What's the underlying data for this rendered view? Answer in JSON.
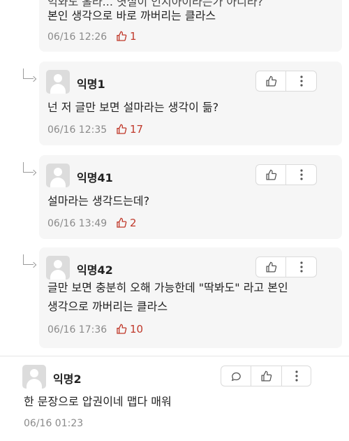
{
  "top_comment": {
    "line1": "억와도  홀라...  엿실이 인지아이라는가 아니라?",
    "line2": "본인 생각으로 바로 까버리는 클라스",
    "time": "06/16 12:26",
    "likes": "1"
  },
  "replies": [
    {
      "nickname": "익명1",
      "text": "넌 저 글만 보면 설마라는 생각이 듦?",
      "time": "06/16 12:35",
      "likes": "17"
    },
    {
      "nickname": "익명41",
      "text": "설마라는 생각드는데?",
      "time": "06/16 13:49",
      "likes": "2"
    },
    {
      "nickname": "익명42",
      "text_line1": "글만 보면 충분히 오해 가능한데 \"딱봐도\" 라고 본인",
      "text_line2": "생각으로 까버리는 클라스",
      "time": "06/16 17:36",
      "likes": "10"
    }
  ],
  "comment": {
    "nickname": "익명2",
    "text": "한 문장으로 압권이네 맵다 매워",
    "time": "06/16 01:23"
  },
  "icons": {
    "like": "thumbs-up-icon",
    "more": "more-vertical-icon",
    "reply": "speech-bubble-icon",
    "reply_arrow": "reply-arrow-icon"
  },
  "colors": {
    "like_accent": "#c0392b",
    "card_bg": "#f6f6f6"
  }
}
